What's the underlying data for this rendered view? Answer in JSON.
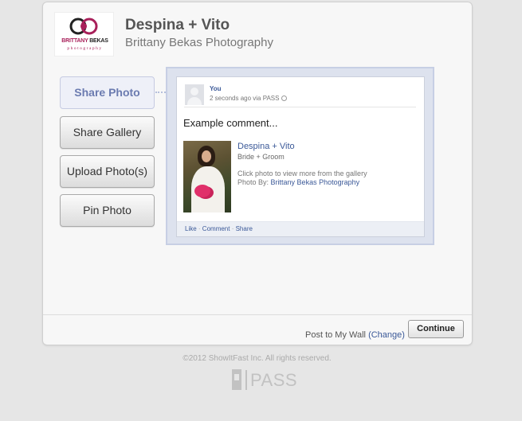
{
  "header": {
    "title": "Despina + Vito",
    "subtitle": "Brittany Bekas Photography",
    "logo": {
      "brand_first": "BRITTANY",
      "brand_second": "BEKAS",
      "tagline": "photography"
    }
  },
  "sidebar": {
    "items": [
      {
        "label": "Share Photo",
        "active": true
      },
      {
        "label": "Share Gallery",
        "active": false
      },
      {
        "label": "Upload Photo(s)",
        "active": false
      },
      {
        "label": "Pin Photo",
        "active": false
      }
    ]
  },
  "post": {
    "author": "You",
    "meta": "2 seconds ago via PASS",
    "comment": "Example comment...",
    "link_title": "Despina + Vito",
    "link_subtitle": "Bride + Groom",
    "link_description": "Click photo to view more from the gallery",
    "photo_by_label": "Photo By:",
    "photo_by_name": "Brittany Bekas Photography",
    "actions": [
      "Like",
      "Comment",
      "Share"
    ]
  },
  "footer": {
    "post_to_label": "Post to My Wall",
    "change_label": "(Change)",
    "continue_label": "Continue"
  },
  "page_footer": {
    "copyright": "©2012 ShowItFast Inc. All rights reserved.",
    "brand": "PASS"
  },
  "colors": {
    "accent": "#6b7bb0",
    "facebook_link": "#3b5998",
    "logo_pink": "#a8205a"
  }
}
